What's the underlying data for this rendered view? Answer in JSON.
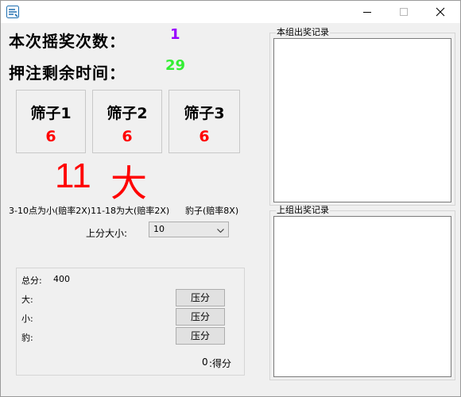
{
  "window": {
    "minimize_icon": "minimize-icon",
    "maximize_icon": "maximize-icon",
    "close_icon": "close-icon"
  },
  "round": {
    "label": "本次摇奖次数：",
    "value": "1",
    "value_color": "#9900ff"
  },
  "countdown": {
    "label": "押注剩余时间：",
    "value": "29",
    "value_color": "#33ee33"
  },
  "dice": [
    {
      "title": "筛子1",
      "value": "6"
    },
    {
      "title": "筛子2",
      "value": "6"
    },
    {
      "title": "筛子3",
      "value": "6"
    }
  ],
  "result": {
    "sum": "11",
    "big_small": "大",
    "color": "#ff0000"
  },
  "rules": {
    "small_big": "3-10点为小(赔率2X)11-18为大(赔率2X)",
    "triple": "豹子(赔率8X)"
  },
  "bet_amount": {
    "label": "上分大小:",
    "selected": "10"
  },
  "betting": {
    "total_label": "总分:",
    "total_value": "400",
    "big_label": "大:",
    "small_label": "小:",
    "triple_label": "豹:",
    "bet_button_label": "压分",
    "score_value": "0",
    "score_label": ":得分"
  },
  "records": {
    "current_title": "本组出奖记录",
    "previous_title": "上组出奖记录"
  }
}
